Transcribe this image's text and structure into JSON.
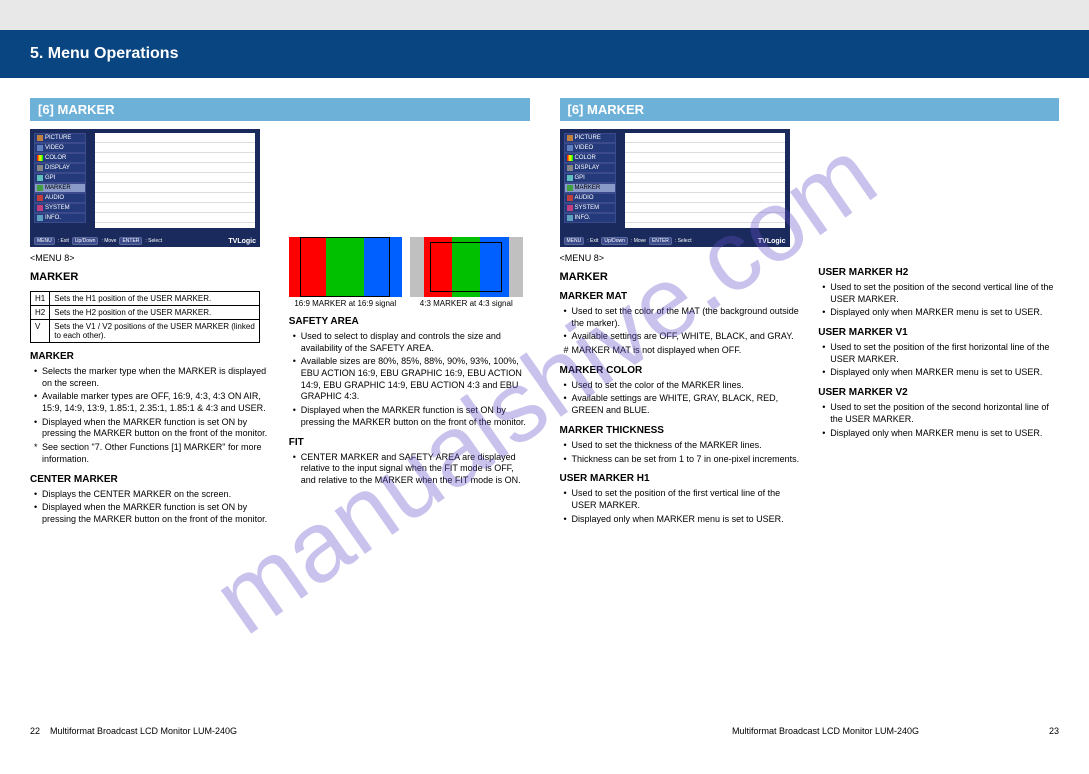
{
  "page": {
    "chapter_title": "5. Menu Operations",
    "footer_model": "Multiformat Broadcast LCD Monitor LUM-240G",
    "page_number_left": "22",
    "page_number_right": "23"
  },
  "menu_screenshot": {
    "items": [
      "PICTURE",
      "VIDEO",
      "COLOR",
      "DISPLAY",
      "GPI",
      "MARKER",
      "AUDIO",
      "SYSTEM",
      "INFO."
    ],
    "selected_index": 5,
    "footer_ok_exit": ": Exit",
    "footer_updown": ": Move",
    "footer_select": ": Select",
    "logo": "TVLogic"
  },
  "left": {
    "subheader": "[6] MARKER",
    "menu_number": "<MENU 8>",
    "title": "MARKER",
    "marker_sub": "MARKER",
    "marker_bul1": "Selects the marker type when the MARKER is displayed on the screen.",
    "marker_bul2": "Available marker types are OFF, 16:9, 4:3, 4:3 ON AIR, 15:9, 14:9, 13:9, 1.85:1, 2.35:1, 1.85:1 & 4:3 and USER.",
    "marker_bul3": "Displayed when the MARKER function is set ON by pressing the MARKER button on the front of the monitor.",
    "marker_bul4": "See section \"7. Other Functions [1] MARKER\" for more information.",
    "center_sub": "CENTER MARKER",
    "center_bul1": "Displays the CENTER MARKER on the screen.",
    "center_bul2": "Displayed when the MARKER function is set ON by pressing the MARKER button on the front of the monitor.",
    "safety_sub": "SAFETY AREA",
    "safety_bul1": "Used to select to display and controls the size and availability of the SAFETY AREA.",
    "safety_bul2": "Available sizes are 80%, 85%, 88%, 90%, 93%, 100%, EBU ACTION 16:9, EBU GRAPHIC 16:9, EBU ACTION 14:9, EBU GRAPHIC 14:9, EBU ACTION 4:3 and EBU GRAPHIC 4:3.",
    "safety_bul3": "Displayed when the MARKER function is set ON by pressing the MARKER button on the front of the monitor.",
    "fit_sub": "FIT",
    "fit_bul1": "CENTER MARKER and SAFETY AREA are displayed relative to the input signal when the FIT mode is OFF, and relative to the MARKER when the FIT mode is ON.",
    "marker_size": {
      "h1_label": "H1",
      "h1_val": "Sets the H1 position of the USER MARKER.",
      "h2_label": "H2",
      "h2_val": "Sets the H2 position of the USER MARKER.",
      "v_label": "V",
      "v_val": "Sets the V1 / V2 positions of the USER MARKER (linked to each other)."
    },
    "aspect169_label": "16:9 MARKER at 16:9 signal",
    "aspect43_label": "4:3 MARKER at 4:3 signal"
  },
  "right": {
    "subheader": "[6] MARKER",
    "menu_number": "<MENU 8>",
    "title": "MARKER",
    "mat_sub": "MARKER MAT",
    "mat_bul1": "Used to set the color of the MAT (the background outside the marker).",
    "mat_bul2": "Available settings are OFF, WHITE, BLACK, and GRAY.",
    "mat_bul3": "MARKER MAT is not displayed when OFF.",
    "color_sub": "MARKER COLOR",
    "color_bul1": "Used to set the color of the MARKER lines.",
    "color_bul2": "Available settings are WHITE, GRAY, BLACK, RED, GREEN and BLUE.",
    "thick_sub": "MARKER THICKNESS",
    "thick_bul1": "Used to set the thickness of the MARKER lines.",
    "thick_bul2": "Thickness can be set from 1 to 7 in one-pixel increments.",
    "usermarker_sub": "USER MARKER H1",
    "usermarker_bul1": "Used to set the position of the first vertical line of the USER MARKER.",
    "usermarker_bul2": "Displayed only when MARKER menu is set to USER.",
    "usermarker2_sub": "USER MARKER H2",
    "usermarker2_bul1": "Used to set the position of the second vertical line of the USER MARKER.",
    "usermarker2_bul2": "Displayed only when MARKER menu is set to USER.",
    "usermarkerv1_sub": "USER MARKER V1",
    "usermarkerv1_bul1": "Used to set the position of the first horizontal line of the USER MARKER.",
    "usermarkerv1_bul2": "Displayed only when MARKER menu is set to USER.",
    "usermarkerv2_sub": "USER MARKER V2",
    "usermarkerv2_bul1": "Used to set the position of the second horizontal line of the USER MARKER.",
    "usermarkerv2_bul2": "Displayed only when MARKER menu is set to USER."
  }
}
